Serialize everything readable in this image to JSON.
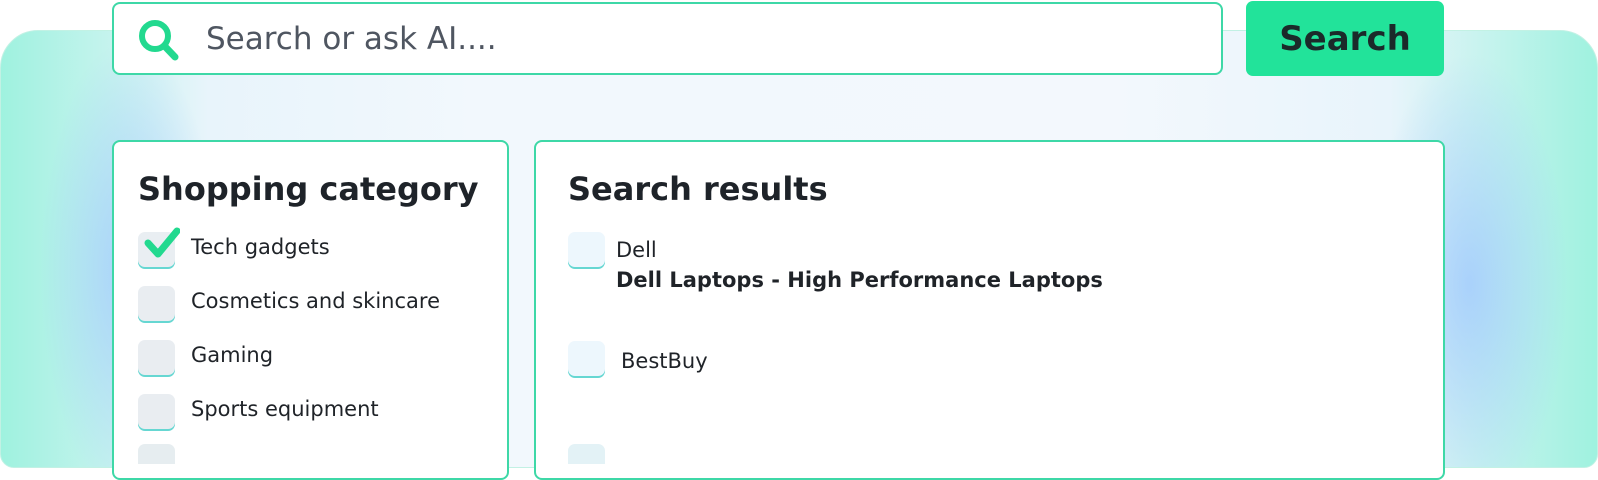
{
  "search": {
    "placeholder": "Search or ask AI....",
    "value": "",
    "button_label": "Search"
  },
  "categories": {
    "title": "Shopping category",
    "items": [
      {
        "label": "Tech gadgets",
        "checked": true
      },
      {
        "label": "Cosmetics and skincare",
        "checked": false
      },
      {
        "label": "Gaming",
        "checked": false
      },
      {
        "label": "Sports equipment",
        "checked": false
      }
    ]
  },
  "results": {
    "title": "Search results",
    "items": [
      {
        "source": "Dell",
        "title": "Dell Laptops - High Performance Laptops",
        "checked": false
      },
      {
        "source": "BestBuy",
        "title": "",
        "checked": false
      }
    ]
  },
  "colors": {
    "accent": "#22e39a",
    "border": "#3ed8a7",
    "checkmark": "#22d98f",
    "text": "#1f2328"
  },
  "icons": [
    "search-icon",
    "checkmark-icon"
  ]
}
